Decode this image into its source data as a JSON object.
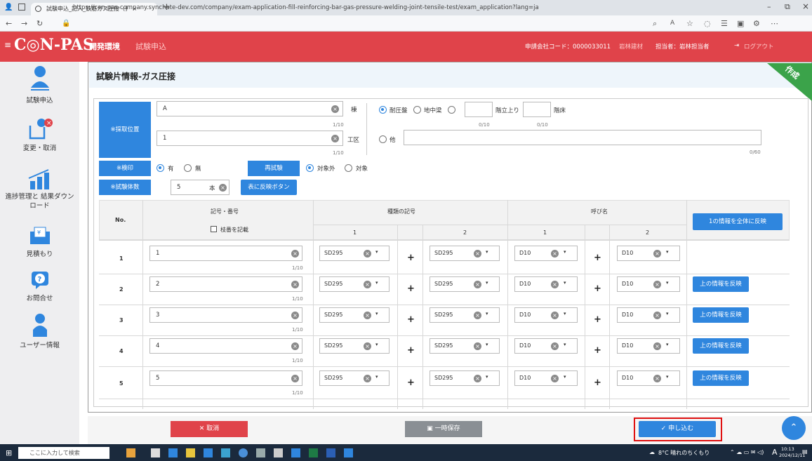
{
  "browser": {
    "tab_title": "試験申込_記入_鉄筋ガス圧接（扌 ×",
    "new_tab": "+",
    "url": "https://con-pas-company.synchate-dev.com/company/exam-application-fill-reinforcing-bar-gas-pressure-welding-joint-tensile-test/exam_application?lang=ja",
    "window_min": "–",
    "window_restore": "⧉",
    "window_close": "×"
  },
  "header": {
    "logo": "C◎N-PAS",
    "env": "開発環境",
    "page": "試験申込",
    "company_code": "申請会社コード：0000033011",
    "company_name": "岩林建材",
    "user": "担当者：岩林担当者",
    "logout": "ログアウト"
  },
  "sidebar": {
    "items": [
      {
        "label": "試験申込",
        "icon": "person-icon"
      },
      {
        "label": "変更・取消",
        "icon": "edit-cancel-icon"
      },
      {
        "label": "進捗管理と 結果ダウンロード",
        "icon": "bar-chart-icon"
      },
      {
        "label": "見積もり",
        "icon": "yen-envelope-icon"
      },
      {
        "label": "お問合せ",
        "icon": "question-icon"
      },
      {
        "label": "ユーザー情報",
        "icon": "user-icon"
      }
    ]
  },
  "main": {
    "title": "試験片情報-ガス圧接",
    "ribbon": "作成",
    "sampling_label": "※採取位置",
    "field_a": {
      "value": "A",
      "count": "1/10",
      "suffix": "棟"
    },
    "field_b": {
      "value": "1",
      "count": "1/10",
      "suffix": "工区"
    },
    "location_opts": {
      "opt1": "耐圧盤",
      "opt2": "地中梁",
      "floor_count": "0/10",
      "floor_suffix": "階立上り",
      "slab_count": "0/10",
      "slab_suffix": "階床"
    },
    "other": {
      "label": "他",
      "count": "0/60"
    },
    "seal": {
      "label": "※検印",
      "yes": "有",
      "no": "無"
    },
    "retest": {
      "label": "再試験",
      "exclude": "対象外",
      "include": "対象"
    },
    "specimens": {
      "label": "※試験体数",
      "value": "5",
      "unit": "本",
      "apply_btn": "表に反映ボタン"
    }
  },
  "table": {
    "col_no": "No.",
    "col_mark": "記号・番号",
    "check_label": "枝番を記載",
    "col_grade": "種類の記号",
    "col_size": "呼び名",
    "sub1": "1",
    "sub2": "2",
    "apply_all_btn": "1の情報を全体に反映",
    "apply_above_btn": "上の情報を反映",
    "plus": "+",
    "rows": [
      {
        "no": "1",
        "mark": "1",
        "count": "1/10",
        "grade1": "SD295",
        "grade2": "SD295",
        "size1": "D10",
        "size2": "D10"
      },
      {
        "no": "2",
        "mark": "2",
        "count": "1/10",
        "grade1": "SD295",
        "grade2": "SD295",
        "size1": "D10",
        "size2": "D10"
      },
      {
        "no": "3",
        "mark": "3",
        "count": "1/10",
        "grade1": "SD295",
        "grade2": "SD295",
        "size1": "D10",
        "size2": "D10"
      },
      {
        "no": "4",
        "mark": "4",
        "count": "1/10",
        "grade1": "SD295",
        "grade2": "SD295",
        "size1": "D10",
        "size2": "D10"
      },
      {
        "no": "5",
        "mark": "5",
        "count": "1/10",
        "grade1": "SD295",
        "grade2": "SD295",
        "size1": "D10",
        "size2": "D10"
      }
    ]
  },
  "footer": {
    "cancel": "取消",
    "save": "一時保存",
    "submit": "申し込む"
  },
  "taskbar": {
    "search": "ここに入力して検索",
    "weather": "8°C 晴れのちくもり",
    "ime": "A",
    "time": "10:13",
    "date": "2024/12/11"
  },
  "colors": {
    "header": "#e0434a",
    "primary": "#2f86de",
    "ribbon": "#3ba34a"
  }
}
